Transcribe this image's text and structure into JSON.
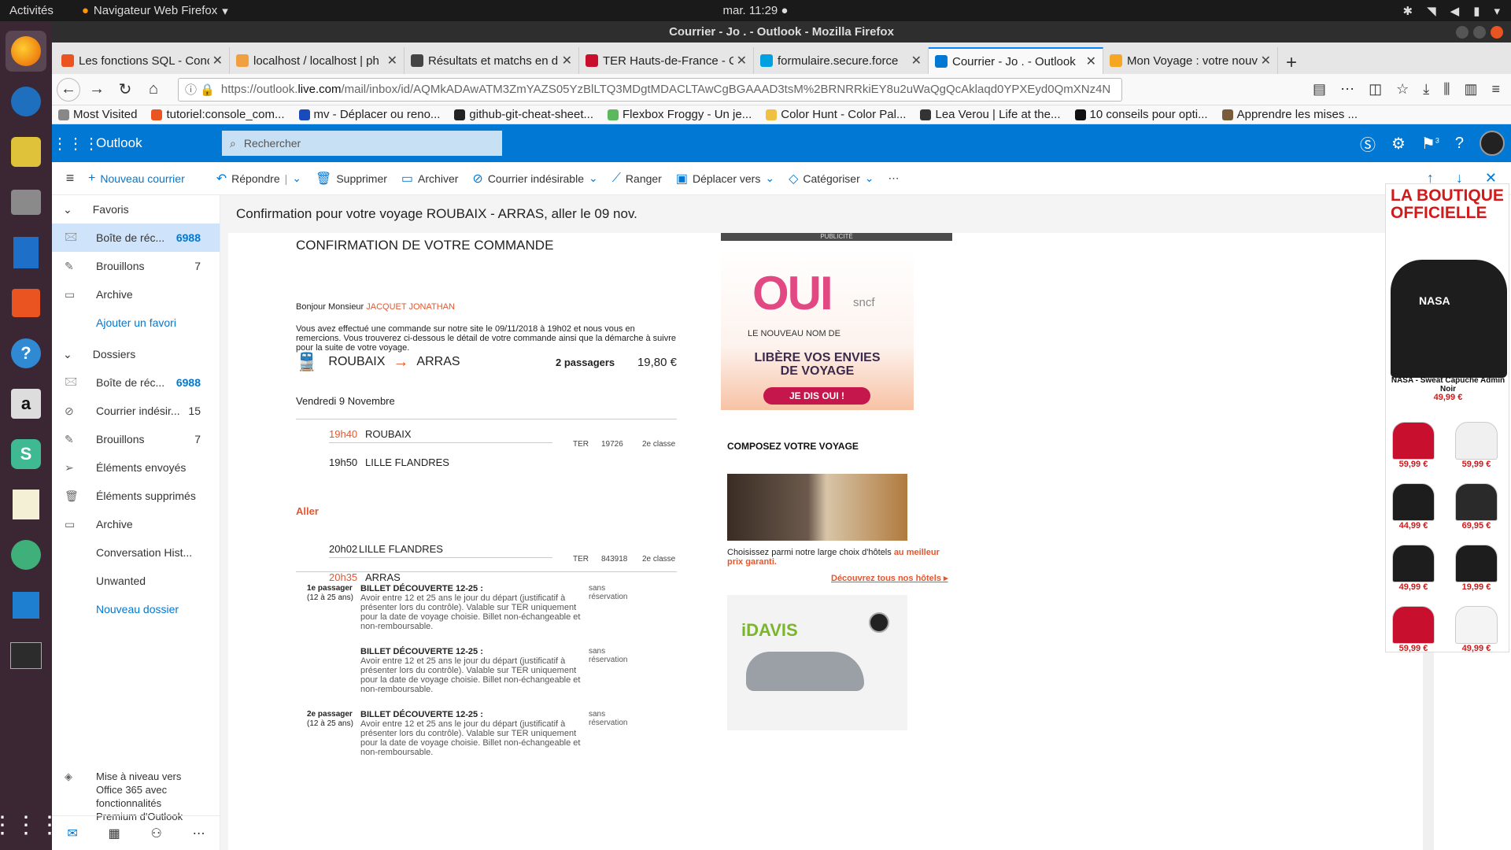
{
  "system": {
    "activities": "Activités",
    "app_name": "Navigateur Web Firefox",
    "clock": "mar. 11:29 ●"
  },
  "window": {
    "title": "Courrier - Jo . - Outlook - Mozilla Firefox"
  },
  "tabs": [
    {
      "label": "Les fonctions SQL - Conc",
      "color": "#e95420"
    },
    {
      "label": "localhost / localhost | ph",
      "color": "#f0a040"
    },
    {
      "label": "Résultats et matchs en d",
      "color": "#444444"
    },
    {
      "label": "TER Hauts-de-France - Co",
      "color": "#c8102e"
    },
    {
      "label": "formulaire.secure.force",
      "color": "#00a1e0"
    },
    {
      "label": "Courrier - Jo . - Outlook",
      "color": "#0078d4"
    },
    {
      "label": "Mon Voyage : votre nouv",
      "color": "#f5a623"
    }
  ],
  "url": {
    "prefix": "https://outlook.",
    "domain": "live.com",
    "rest": "/mail/inbox/id/AQMkADAwATM3ZmYAZS05YzBlLTQ3MDgtMDACLTAwCgBGAAAD3tsM%2BRNRRkiEY8u2uWaQgQcAklaqd0YPXEyd0QmXNz4N"
  },
  "bookmarks": [
    {
      "label": "Most Visited",
      "color": "#888888"
    },
    {
      "label": "tutoriel:console_com...",
      "color": "#e95420"
    },
    {
      "label": "mv - Déplacer ou reno...",
      "color": "#1a4bbd"
    },
    {
      "label": "github-git-cheat-sheet...",
      "color": "#222222"
    },
    {
      "label": "Flexbox Froggy - Un je...",
      "color": "#5cb85c"
    },
    {
      "label": "Color Hunt - Color Pal...",
      "color": "#f0c040"
    },
    {
      "label": "Lea Verou | Life at the...",
      "color": "#333333"
    },
    {
      "label": "10 conseils pour opti...",
      "color": "#111111"
    },
    {
      "label": "Apprendre les mises ...",
      "color": "#7a5c3a"
    }
  ],
  "outlook": {
    "brand": "Outlook",
    "search_placeholder": "Rechercher",
    "notif_count": "3"
  },
  "commands": {
    "new_mail": "Nouveau courrier",
    "reply": "Répondre",
    "delete": "Supprimer",
    "archive": "Archiver",
    "junk": "Courrier indésirable",
    "sweep": "Ranger",
    "move": "Déplacer vers",
    "categorize": "Catégoriser"
  },
  "favorites": {
    "title": "Favoris",
    "items": [
      {
        "label": "Boîte de réc...",
        "count": "6988"
      },
      {
        "label": "Brouillons",
        "count": "7"
      },
      {
        "label": "Archive",
        "count": ""
      }
    ],
    "add": "Ajouter un favori"
  },
  "folders": {
    "title": "Dossiers",
    "items": [
      {
        "label": "Boîte de réc...",
        "count": "6988"
      },
      {
        "label": "Courrier indésir...",
        "count": "15"
      },
      {
        "label": "Brouillons",
        "count": "7"
      },
      {
        "label": "Éléments envoyés",
        "count": ""
      },
      {
        "label": "Éléments supprimés",
        "count": ""
      },
      {
        "label": "Archive",
        "count": ""
      },
      {
        "label": "Conversation Hist...",
        "count": ""
      },
      {
        "label": "Unwanted",
        "count": ""
      }
    ],
    "new": "Nouveau dossier"
  },
  "upgrade": {
    "line1": "Mise à niveau vers",
    "line2": "Office 365 avec",
    "line3": "fonctionnalités",
    "line4": "Premium d'Outlook"
  },
  "message": {
    "subject": "Confirmation pour votre voyage ROUBAIX - ARRAS, aller le 09 nov.",
    "heading": "CONFIRMATION DE VOTRE COMMANDE",
    "greeting": "Bonjour Monsieur ",
    "name": "JACQUET JONATHAN",
    "intro": "Vous avez effectué une commande sur notre site le 09/11/2018  à 19h02 et nous vous en remercions. Vous trouverez ci-dessous le détail de votre commande ainsi que la démarche à suivre pour la suite de votre voyage.",
    "origin": "ROUBAIX",
    "destination": "ARRAS",
    "passengers": "2 passagers",
    "price": "19,80 €",
    "date": "Vendredi 9 Novembre",
    "aller": "Aller",
    "legs": [
      {
        "dep_time": "19h40",
        "dep_station": "ROUBAIX",
        "arr_time": "19h50",
        "arr_station": "LILLE FLANDRES",
        "type": "TER",
        "number": "19726",
        "class": "2e classe"
      },
      {
        "dep_time": "20h02",
        "dep_station": "LILLE FLANDRES",
        "arr_time": "20h35",
        "arr_station": "ARRAS",
        "type": "TER",
        "number": "843918",
        "class": "2e classe"
      }
    ],
    "tickets": [
      {
        "passenger": "1e passager",
        "age": "(12 à 25 ans)",
        "title": "BILLET DÉCOUVERTE 12-25 :",
        "desc": "Avoir entre 12 et 25 ans le jour du départ (justificatif à présenter lors du contrôle). Valable sur TER uniquement pour la date de voyage choisie. Billet non-échangeable et non-remboursable.",
        "reservation": "sans réservation"
      },
      {
        "passenger": "",
        "age": "",
        "title": "BILLET DÉCOUVERTE 12-25 :",
        "desc": "Avoir entre 12 et 25 ans le jour du départ (justificatif à présenter lors du contrôle). Valable sur TER uniquement pour la date de voyage choisie. Billet non-échangeable et non-remboursable.",
        "reservation": "sans réservation"
      },
      {
        "passenger": "2e passager",
        "age": "(12 à 25 ans)",
        "title": "BILLET DÉCOUVERTE 12-25 :",
        "desc": "Avoir entre 12 et 25 ans le jour du départ (justificatif à présenter lors du contrôle). Valable sur TER uniquement pour la date de voyage choisie. Billet non-échangeable et non-remboursable.",
        "reservation": "sans réservation"
      }
    ]
  },
  "side_ads": {
    "pub": "PUBLICITÉ",
    "oui": "OUI",
    "sncf": "sncf",
    "new_name": "LE NOUVEAU NOM DE",
    "tagline1": "LIBÈRE VOS ENVIES",
    "tagline2": "DE VOYAGE",
    "cta": "JE DIS OUI !",
    "compose": "COMPOSEZ VOTRE VOYAGE",
    "hotel_text": "Choisissez parmi notre large choix d'hôtels ",
    "hotel_highlight": "au meilleur prix garanti.",
    "hotel_link": "Découvrez tous nos hôtels",
    "idavis_id": "iD",
    "idavis_rest": "AVIS"
  },
  "boutique": {
    "title1": "LA BOUTIQUE",
    "title2": "OFFICIELLE",
    "main_name": "NASA - Sweat Capuche Admin Noir",
    "main_price": "49,99 €",
    "main_label": "NASA",
    "thumbs": [
      {
        "price": "59,99 €",
        "color": "#c8102e"
      },
      {
        "price": "59,99 €",
        "color": "#f0f0f0"
      },
      {
        "price": "44,99 €",
        "color": "#1d1d1d"
      },
      {
        "price": "69,95 €",
        "color": "#2a2a2a"
      },
      {
        "price": "49,99 €",
        "color": "#1d1d1d"
      },
      {
        "price": "19,99 €",
        "color": "#1d1d1d"
      },
      {
        "price": "59,99 €",
        "color": "#c8102e"
      },
      {
        "price": "49,99 €",
        "color": "#f4f4f4"
      }
    ]
  }
}
